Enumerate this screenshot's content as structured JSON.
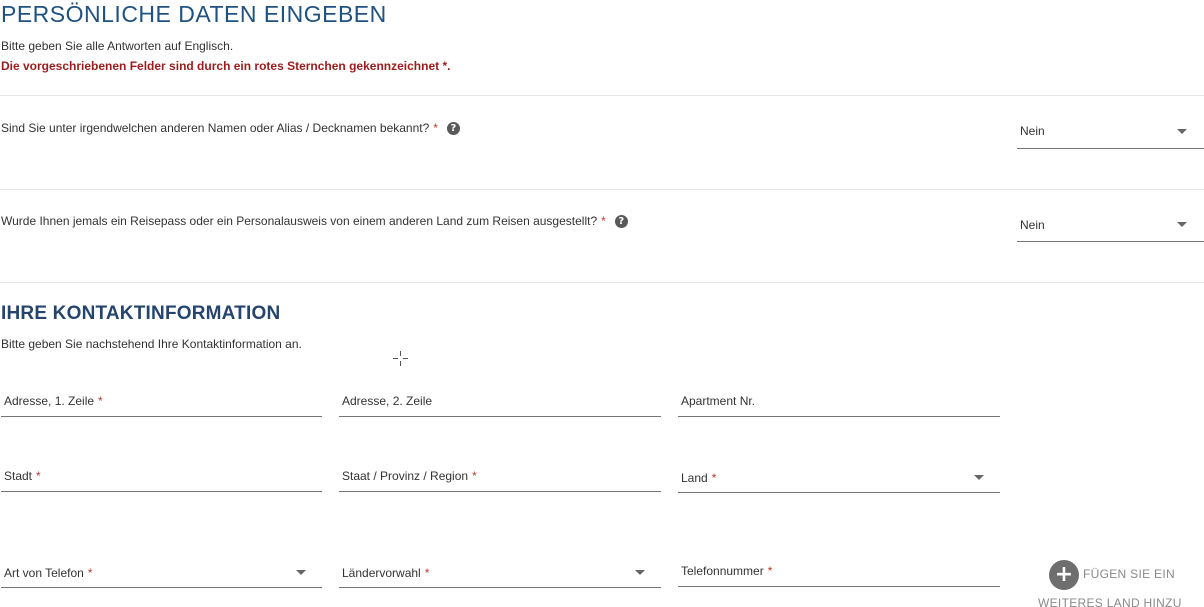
{
  "personal": {
    "title": "PERSÖNLICHE DATEN EINGEBEN",
    "intro_text": "Bitte geben Sie alle Antworten auf Englisch.",
    "required_note": "Die vorgeschriebenen Felder sind durch ein rotes Sternchen gekennzeichnet *."
  },
  "questions": [
    {
      "label": "Sind Sie unter irgendwelchen anderen Namen oder Alias / Decknamen bekannt?",
      "required_mark": "*",
      "help_icon": "question-circle-icon",
      "value": "Nein"
    },
    {
      "label": "Wurde Ihnen jemals ein Reisepass oder ein Personalausweis von einem anderen Land zum Reisen ausgestellt?",
      "required_mark": "*",
      "help_icon": "question-circle-icon",
      "value": "Nein"
    }
  ],
  "contact": {
    "title": "IHRE KONTAKTINFORMATION",
    "intro_text": "Bitte geben Sie nachstehend Ihre Kontaktinformation an.",
    "fields": {
      "address1": {
        "label": "Adresse, 1. Zeile",
        "required_mark": "*"
      },
      "address2": {
        "label": "Adresse, 2. Zeile"
      },
      "apartment": {
        "label": "Apartment Nr."
      },
      "city": {
        "label": "Stadt",
        "required_mark": "*"
      },
      "state": {
        "label": "Staat / Provinz / Region",
        "required_mark": "*"
      },
      "country": {
        "label": "Land",
        "required_mark": "*"
      },
      "phone_type": {
        "label": "Art von Telefon",
        "required_mark": "*"
      },
      "country_code": {
        "label": "Ländervorwahl",
        "required_mark": "*"
      },
      "phone_number": {
        "label": "Telefonnummer",
        "required_mark": "*"
      }
    },
    "add_country": {
      "icon": "plus-circle-icon",
      "line1": "FÜGEN SIE EIN",
      "line2": "WEITERES LAND HINZU"
    }
  },
  "colors": {
    "title_blue": "#205280",
    "section_blue": "#26456e",
    "required_red": "#9b1c1c"
  }
}
